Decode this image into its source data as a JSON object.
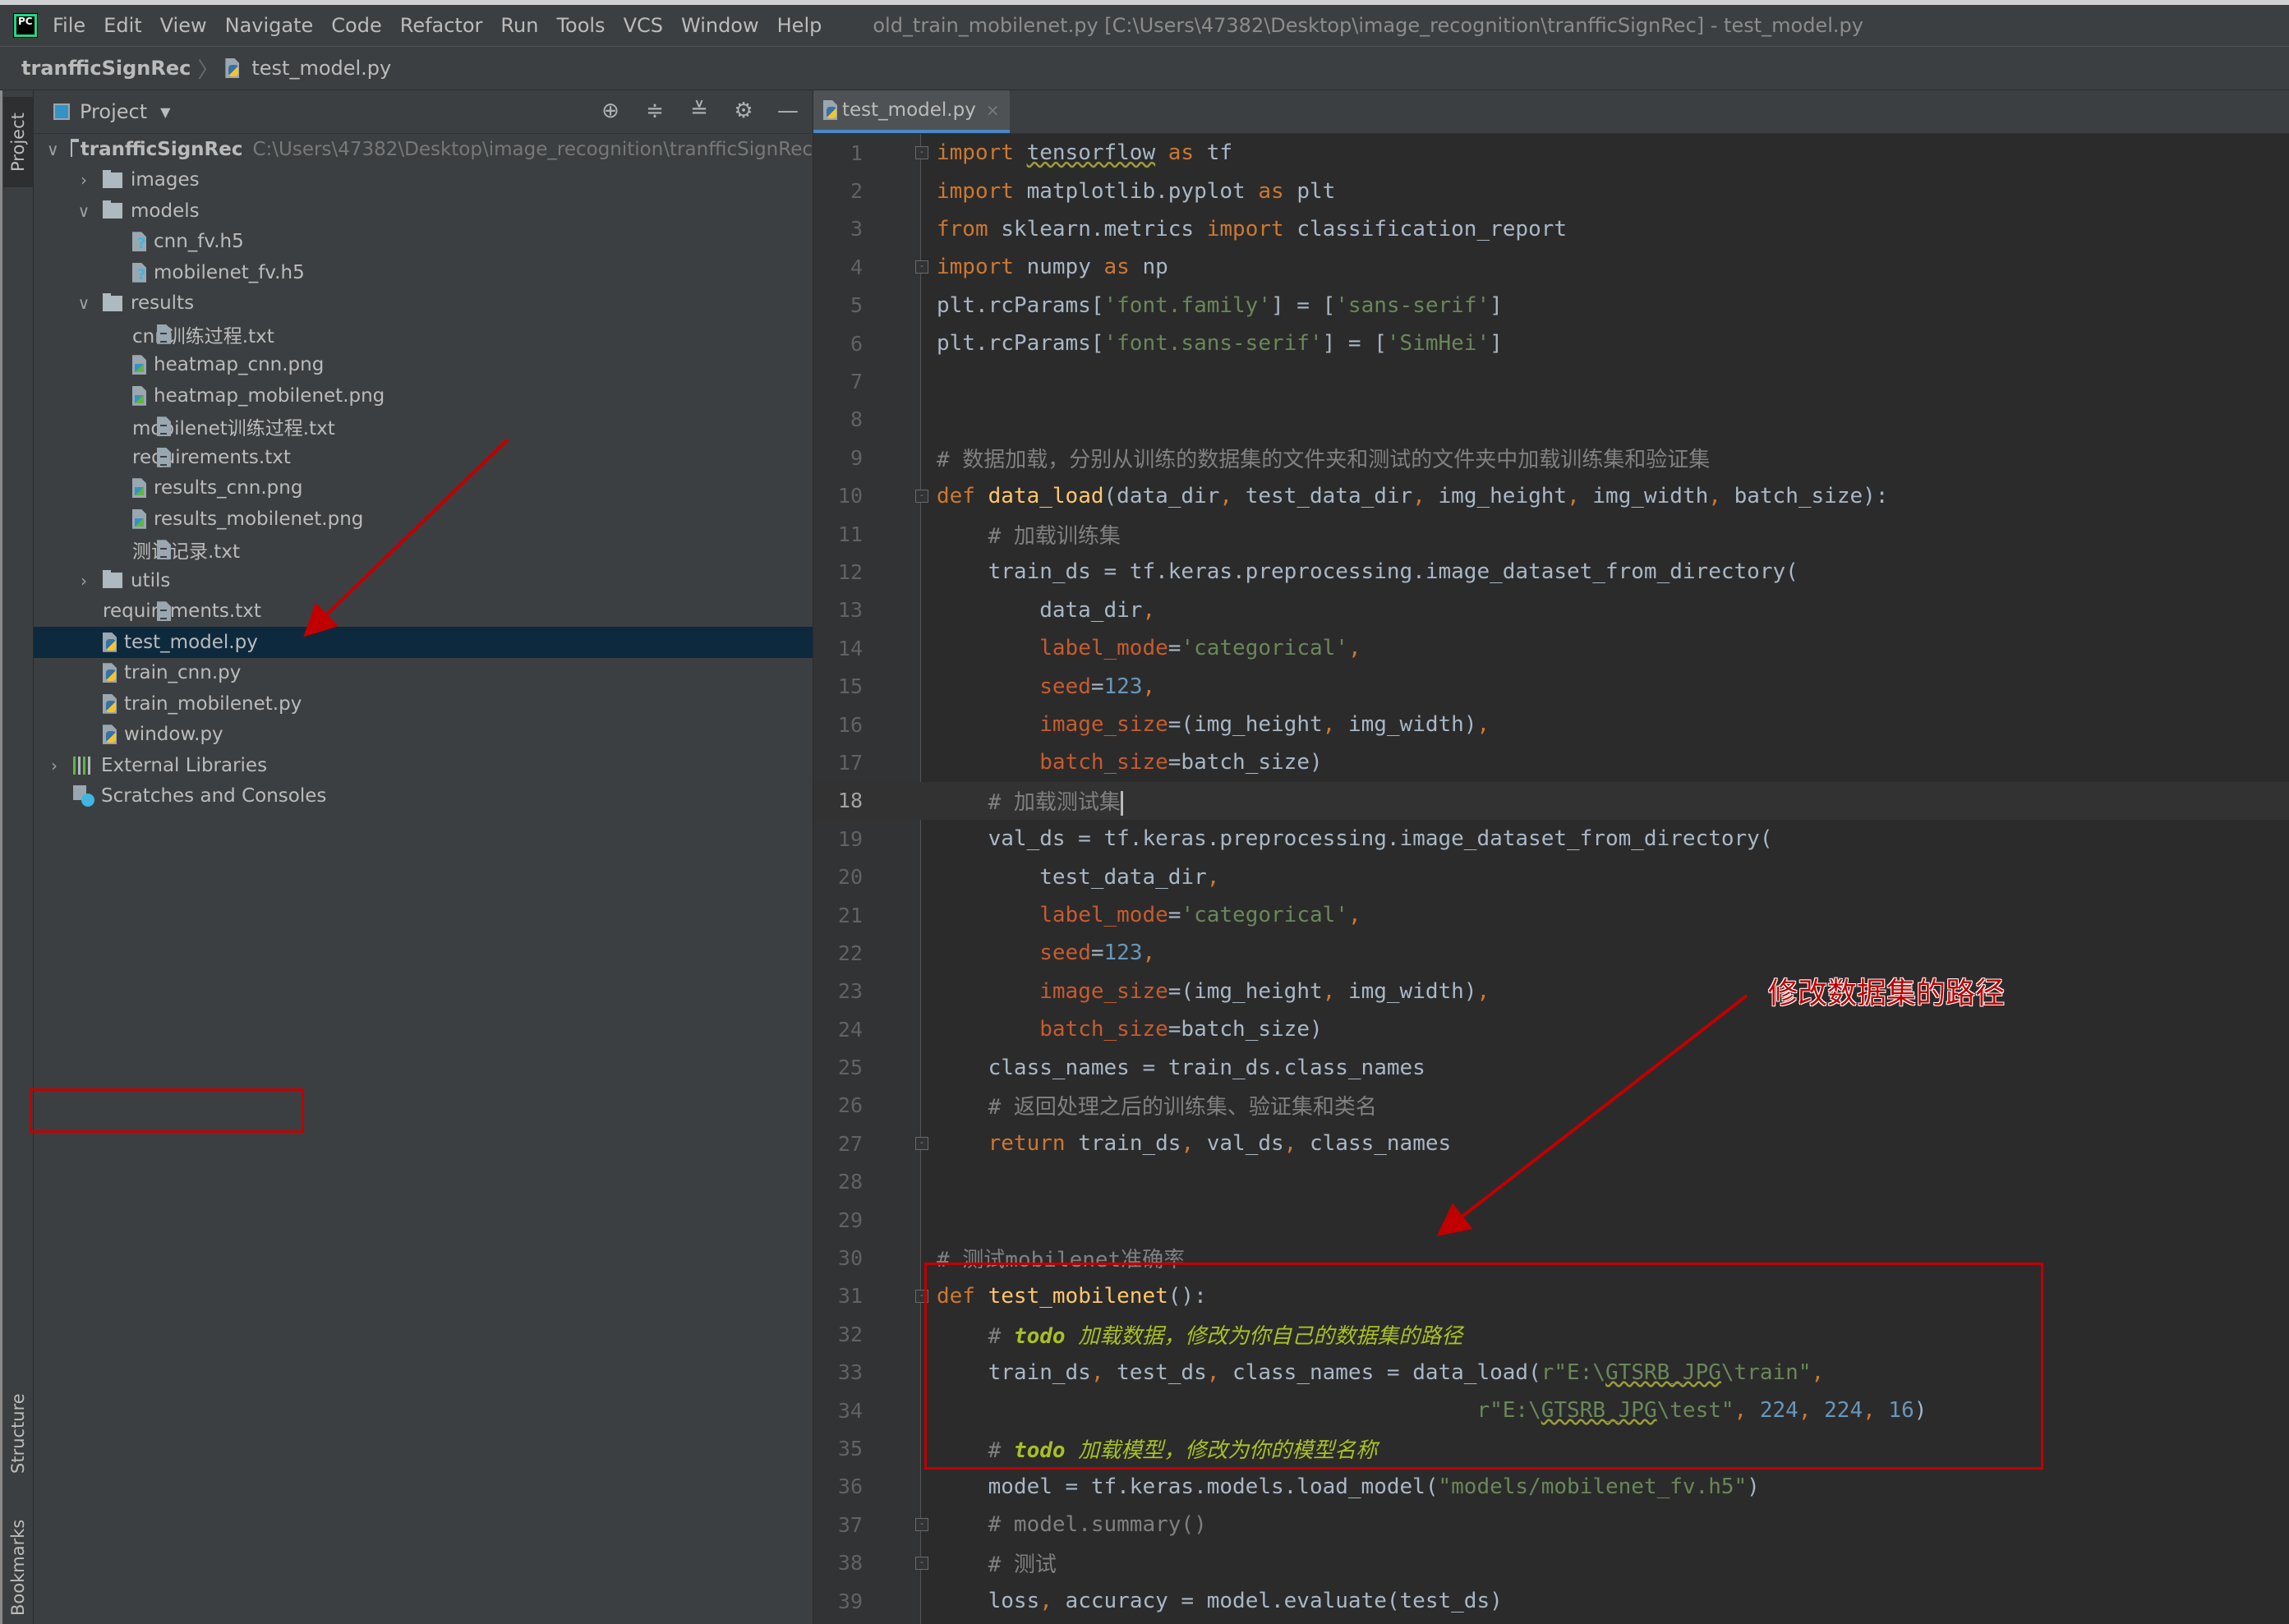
{
  "menubar": {
    "logo": "PC",
    "items": [
      "File",
      "Edit",
      "View",
      "Navigate",
      "Code",
      "Refactor",
      "Run",
      "Tools",
      "VCS",
      "Window",
      "Help"
    ],
    "window_title": "old_train_mobilenet.py [C:\\Users\\47382\\Desktop\\image_recognition\\tranfficSignRec] - test_model.py"
  },
  "breadcrumb": {
    "root": "tranfficSignRec",
    "sep": "〉",
    "file": "test_model.py"
  },
  "left_strip": {
    "tabs": [
      "Project",
      "Structure",
      "Bookmarks"
    ]
  },
  "project_panel": {
    "title": "Project",
    "dropdown": "▼",
    "tools": {
      "locate": "⊕",
      "expand": "≑",
      "collapse": "≚",
      "settings": "⚙",
      "hide": "—"
    },
    "tree": [
      {
        "level": 0,
        "arrow": "∨",
        "type": "folder",
        "label": "tranfficSignRec",
        "path": "C:\\Users\\47382\\Desktop\\image_recognition\\tranfficSignRec",
        "bold": true
      },
      {
        "level": 1,
        "arrow": "›",
        "type": "folder",
        "label": "images"
      },
      {
        "level": 1,
        "arrow": "∨",
        "type": "folder",
        "label": "models"
      },
      {
        "level": 2,
        "arrow": "",
        "type": "h5",
        "label": "cnn_fv.h5"
      },
      {
        "level": 2,
        "arrow": "",
        "type": "h5",
        "label": "mobilenet_fv.h5"
      },
      {
        "level": 1,
        "arrow": "∨",
        "type": "folder",
        "label": "results"
      },
      {
        "level": 2,
        "arrow": "",
        "type": "txt",
        "label": "cnn训练过程.txt"
      },
      {
        "level": 2,
        "arrow": "",
        "type": "png",
        "label": "heatmap_cnn.png"
      },
      {
        "level": 2,
        "arrow": "",
        "type": "png",
        "label": "heatmap_mobilenet.png"
      },
      {
        "level": 2,
        "arrow": "",
        "type": "txt",
        "label": "mobilenet训练过程.txt"
      },
      {
        "level": 2,
        "arrow": "",
        "type": "txt",
        "label": "requirements.txt"
      },
      {
        "level": 2,
        "arrow": "",
        "type": "png",
        "label": "results_cnn.png"
      },
      {
        "level": 2,
        "arrow": "",
        "type": "png",
        "label": "results_mobilenet.png"
      },
      {
        "level": 2,
        "arrow": "",
        "type": "txt",
        "label": "测试记录.txt"
      },
      {
        "level": 1,
        "arrow": "›",
        "type": "folder",
        "label": "utils"
      },
      {
        "level": 1,
        "arrow": "",
        "type": "txt",
        "label": "requirements.txt"
      },
      {
        "level": 1,
        "arrow": "",
        "type": "py",
        "label": "test_model.py",
        "selected": true
      },
      {
        "level": 1,
        "arrow": "",
        "type": "py",
        "label": "train_cnn.py"
      },
      {
        "level": 1,
        "arrow": "",
        "type": "py",
        "label": "train_mobilenet.py"
      },
      {
        "level": 1,
        "arrow": "",
        "type": "py",
        "label": "window.py"
      },
      {
        "level": 0,
        "arrow": "›",
        "type": "lib",
        "label": "External Libraries"
      },
      {
        "level": 0,
        "arrow": "",
        "type": "scratch",
        "label": "Scratches and Consoles"
      }
    ]
  },
  "editor": {
    "tab": {
      "label": "test_model.py",
      "close": "×"
    },
    "current_line": 18,
    "lines": [
      {
        "n": 1,
        "fold": "-",
        "segs": [
          [
            "kw",
            "import "
          ],
          [
            "squig",
            "tensorflow"
          ],
          [
            "kw",
            " as "
          ],
          [
            "",
            "tf"
          ]
        ]
      },
      {
        "n": 2,
        "segs": [
          [
            "kw",
            "import "
          ],
          [
            "",
            "matplotlib.pyplot"
          ],
          [
            "kw",
            " as "
          ],
          [
            "",
            "plt"
          ]
        ]
      },
      {
        "n": 3,
        "segs": [
          [
            "kw",
            "from "
          ],
          [
            "",
            "sklearn.metrics "
          ],
          [
            "kw",
            "import "
          ],
          [
            "",
            "classification_report"
          ]
        ]
      },
      {
        "n": 4,
        "fold": "-",
        "segs": [
          [
            "kw",
            "import "
          ],
          [
            "",
            "numpy"
          ],
          [
            "kw",
            " as "
          ],
          [
            "",
            "np"
          ]
        ]
      },
      {
        "n": 5,
        "segs": [
          [
            "",
            "plt.rcParams["
          ],
          [
            "str",
            "'font.family'"
          ],
          [
            "",
            "] = ["
          ],
          [
            "str",
            "'sans-serif'"
          ],
          [
            "",
            "]"
          ]
        ]
      },
      {
        "n": 6,
        "segs": [
          [
            "",
            "plt.rcParams["
          ],
          [
            "str",
            "'font.sans-serif'"
          ],
          [
            "",
            "] = ["
          ],
          [
            "str",
            "'SimHei'"
          ],
          [
            "",
            "]"
          ]
        ]
      },
      {
        "n": 7,
        "segs": []
      },
      {
        "n": 8,
        "segs": []
      },
      {
        "n": 9,
        "segs": [
          [
            "cm",
            "# 数据加载，分别从训练的数据集的文件夹和测试的文件夹中加载训练集和验证集"
          ]
        ]
      },
      {
        "n": 10,
        "fold": "-",
        "segs": [
          [
            "kw",
            "def "
          ],
          [
            "fn",
            "data_load"
          ],
          [
            "",
            "(data_dir"
          ],
          [
            "kw",
            ", "
          ],
          [
            "",
            "test_data_dir"
          ],
          [
            "kw",
            ", "
          ],
          [
            "",
            "img_height"
          ],
          [
            "kw",
            ", "
          ],
          [
            "",
            "img_width"
          ],
          [
            "kw",
            ", "
          ],
          [
            "",
            "batch_size):"
          ]
        ]
      },
      {
        "n": 11,
        "segs": [
          [
            "",
            "    "
          ],
          [
            "cm",
            "# 加载训练集"
          ]
        ]
      },
      {
        "n": 12,
        "segs": [
          [
            "",
            "    train_ds = tf.keras.preprocessing.image_dataset_from_directory("
          ]
        ]
      },
      {
        "n": 13,
        "segs": [
          [
            "",
            "        data_dir"
          ],
          [
            "kw",
            ","
          ]
        ]
      },
      {
        "n": 14,
        "segs": [
          [
            "",
            "        "
          ],
          [
            "param",
            "label_mode"
          ],
          [
            "",
            "="
          ],
          [
            "str",
            "'categorical'"
          ],
          [
            "kw",
            ","
          ]
        ]
      },
      {
        "n": 15,
        "segs": [
          [
            "",
            "        "
          ],
          [
            "param",
            "seed"
          ],
          [
            "",
            "="
          ],
          [
            "num",
            "123"
          ],
          [
            "kw",
            ","
          ]
        ]
      },
      {
        "n": 16,
        "segs": [
          [
            "",
            "        "
          ],
          [
            "param",
            "image_size"
          ],
          [
            "",
            "=(img_height"
          ],
          [
            "kw",
            ", "
          ],
          [
            "",
            "img_width)"
          ],
          [
            "kw",
            ","
          ]
        ]
      },
      {
        "n": 17,
        "segs": [
          [
            "",
            "        "
          ],
          [
            "param",
            "batch_size"
          ],
          [
            "",
            "=batch_size)"
          ]
        ]
      },
      {
        "n": 18,
        "segs": [
          [
            "",
            "    "
          ],
          [
            "cm",
            "# 加载测试集"
          ],
          [
            "caret",
            ""
          ]
        ]
      },
      {
        "n": 19,
        "segs": [
          [
            "",
            "    val_ds = tf.keras.preprocessing.image_dataset_from_directory("
          ]
        ]
      },
      {
        "n": 20,
        "segs": [
          [
            "",
            "        test_data_dir"
          ],
          [
            "kw",
            ","
          ]
        ]
      },
      {
        "n": 21,
        "segs": [
          [
            "",
            "        "
          ],
          [
            "param",
            "label_mode"
          ],
          [
            "",
            "="
          ],
          [
            "str",
            "'categorical'"
          ],
          [
            "kw",
            ","
          ]
        ]
      },
      {
        "n": 22,
        "segs": [
          [
            "",
            "        "
          ],
          [
            "param",
            "seed"
          ],
          [
            "",
            "="
          ],
          [
            "num",
            "123"
          ],
          [
            "kw",
            ","
          ]
        ]
      },
      {
        "n": 23,
        "segs": [
          [
            "",
            "        "
          ],
          [
            "param",
            "image_size"
          ],
          [
            "",
            "=(img_height"
          ],
          [
            "kw",
            ", "
          ],
          [
            "",
            "img_width)"
          ],
          [
            "kw",
            ","
          ]
        ]
      },
      {
        "n": 24,
        "segs": [
          [
            "",
            "        "
          ],
          [
            "param",
            "batch_size"
          ],
          [
            "",
            "=batch_size)"
          ]
        ]
      },
      {
        "n": 25,
        "segs": [
          [
            "",
            "    class_names = train_ds.class_names"
          ]
        ]
      },
      {
        "n": 26,
        "segs": [
          [
            "",
            "    "
          ],
          [
            "cm",
            "# 返回处理之后的训练集、验证集和类名"
          ]
        ]
      },
      {
        "n": 27,
        "fold": "-",
        "segs": [
          [
            "",
            "    "
          ],
          [
            "kw",
            "return "
          ],
          [
            "",
            "train_ds"
          ],
          [
            "kw",
            ", "
          ],
          [
            "",
            "val_ds"
          ],
          [
            "kw",
            ", "
          ],
          [
            "",
            "class_names"
          ]
        ]
      },
      {
        "n": 28,
        "segs": []
      },
      {
        "n": 29,
        "segs": []
      },
      {
        "n": 30,
        "segs": [
          [
            "cm",
            "# 测试mobilenet准确率"
          ]
        ]
      },
      {
        "n": 31,
        "fold": "-",
        "segs": [
          [
            "kw",
            "def "
          ],
          [
            "fn",
            "test_mobilenet"
          ],
          [
            "",
            "():"
          ]
        ]
      },
      {
        "n": 32,
        "segs": [
          [
            "",
            "    "
          ],
          [
            "todo-hash",
            "# "
          ],
          [
            "todo-b",
            "todo"
          ],
          [
            "todo",
            " 加载数据，修改为你自己的数据集的路径"
          ]
        ]
      },
      {
        "n": 33,
        "segs": [
          [
            "",
            "    train_ds"
          ],
          [
            "kw",
            ", "
          ],
          [
            "",
            "test_ds"
          ],
          [
            "kw",
            ", "
          ],
          [
            "",
            "class_names = data_load("
          ],
          [
            "str",
            "r\"E:\\"
          ],
          [
            "strsq",
            "GTSRB_JPG"
          ],
          [
            "str",
            "\\train\""
          ],
          [
            "kw",
            ","
          ]
        ]
      },
      {
        "n": 34,
        "segs": [
          [
            "",
            "                                          "
          ],
          [
            "str",
            "r\"E:\\"
          ],
          [
            "strsq",
            "GTSRB_JPG"
          ],
          [
            "str",
            "\\test\""
          ],
          [
            "kw",
            ", "
          ],
          [
            "num",
            "224"
          ],
          [
            "kw",
            ", "
          ],
          [
            "num",
            "224"
          ],
          [
            "kw",
            ", "
          ],
          [
            "num",
            "16"
          ],
          [
            "",
            ")"
          ]
        ]
      },
      {
        "n": 35,
        "segs": [
          [
            "",
            "    "
          ],
          [
            "todo-hash",
            "# "
          ],
          [
            "todo-b",
            "todo"
          ],
          [
            "todo",
            " 加载模型，修改为你的模型名称"
          ]
        ]
      },
      {
        "n": 36,
        "segs": [
          [
            "",
            "    model = tf.keras.models.load_model("
          ],
          [
            "str",
            "\"models/mobilenet_fv.h5\""
          ],
          [
            "",
            ")"
          ]
        ]
      },
      {
        "n": 37,
        "fold": "-",
        "segs": [
          [
            "",
            "    "
          ],
          [
            "cm",
            "# model.summary()"
          ]
        ]
      },
      {
        "n": 38,
        "fold": "-",
        "segs": [
          [
            "",
            "    "
          ],
          [
            "cm",
            "# 测试"
          ]
        ]
      },
      {
        "n": 39,
        "segs": [
          [
            "",
            "    loss"
          ],
          [
            "kw",
            ", "
          ],
          [
            "",
            "accuracy = model.evaluate(test_ds)"
          ]
        ]
      }
    ]
  },
  "annotations": {
    "callout_text": "修改数据集的路径",
    "accent": "#c00000"
  },
  "colors": {
    "selection": "#0d293e",
    "tab_underline": "#4a88c7",
    "keyword": "#cc7832",
    "string": "#6a8759",
    "number": "#6897bb",
    "comment": "#808080",
    "function": "#ffc66d",
    "todo": "#a8c023"
  }
}
